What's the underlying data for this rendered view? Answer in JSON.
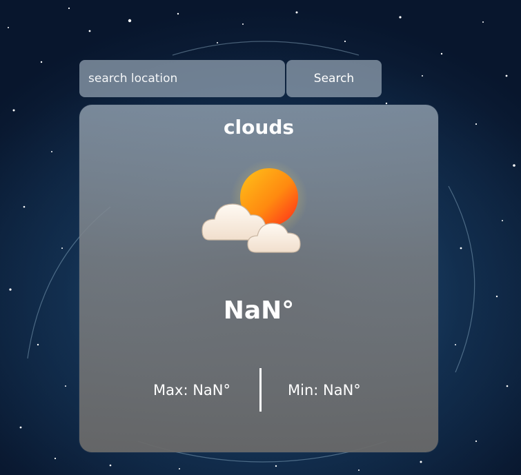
{
  "search": {
    "placeholder": "search location",
    "button_label": "Search"
  },
  "weather": {
    "condition": "clouds",
    "icon": "sun-behind-clouds-icon",
    "temperature": "NaN°",
    "max": "Max: NaN°",
    "min": "Min: NaN°"
  },
  "colors": {
    "panel": "#8c96a0",
    "text": "#ffffff",
    "sun": "#ff7a1a",
    "cloud": "#f5ebe0",
    "background": "#0b2540"
  }
}
